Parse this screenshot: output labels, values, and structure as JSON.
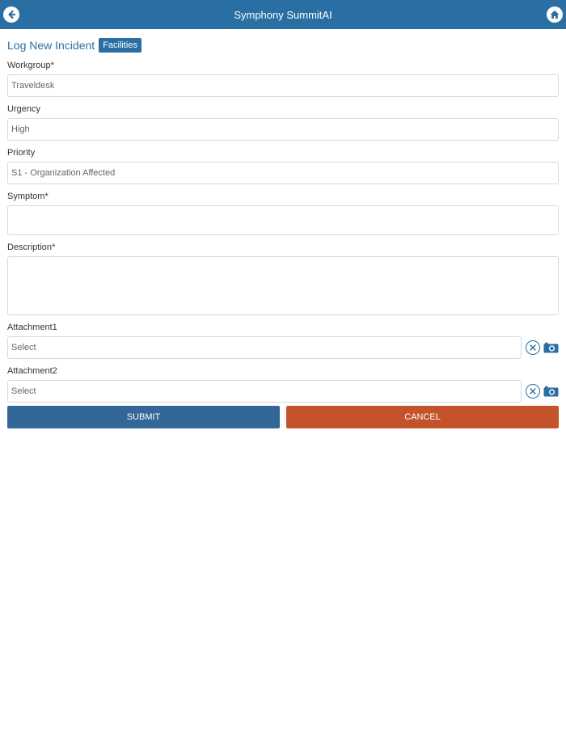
{
  "header": {
    "title": "Symphony SummitAI",
    "back_icon": "back-arrow-icon",
    "home_icon": "home-icon",
    "bar_color": "#2a6fa3"
  },
  "form": {
    "heading": "Log New Incident",
    "badge": "Facilities",
    "workgroup": {
      "label": "Workgroup*",
      "value": "Traveldesk"
    },
    "urgency": {
      "label": "Urgency",
      "value": "High"
    },
    "priority": {
      "label": "Priority",
      "value": "S1 - Organization Affected"
    },
    "symptom": {
      "label": "Symptom*",
      "value": ""
    },
    "description": {
      "label": "Description*",
      "value": ""
    },
    "attachment1": {
      "label": "Attachment1",
      "placeholder": "Select",
      "clear_icon": "clear-circle-icon",
      "camera_icon": "camera-icon"
    },
    "attachment2": {
      "label": "Attachment2",
      "placeholder": "Select",
      "clear_icon": "clear-circle-icon",
      "camera_icon": "camera-icon"
    }
  },
  "actions": {
    "submit": {
      "label": "SUBMIT",
      "color": "#336699"
    },
    "cancel": {
      "label": "CANCEL",
      "color": "#c2532a"
    }
  }
}
